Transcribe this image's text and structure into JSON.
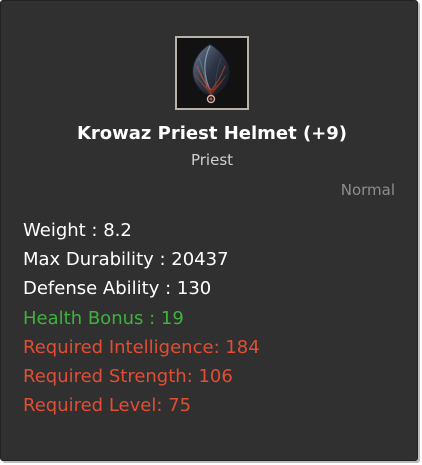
{
  "item": {
    "icon": "helmet-icon",
    "name": "Krowaz Priest Helmet (+9)",
    "class": "Priest",
    "grade": "Normal"
  },
  "stats": [
    {
      "text": "Weight : 8.2",
      "color": "#ffffff"
    },
    {
      "text": "Max Durability : 20437",
      "color": "#ffffff"
    },
    {
      "text": "Defense Ability : 130",
      "color": "#ffffff"
    },
    {
      "text": "Health Bonus : 19",
      "color": "#3fb13f"
    },
    {
      "text": "Required Intelligence: 184",
      "color": "#e24e34"
    },
    {
      "text": "Required Strength: 106",
      "color": "#e24e34"
    },
    {
      "text": "Required Level: 75",
      "color": "#e24e34"
    }
  ]
}
